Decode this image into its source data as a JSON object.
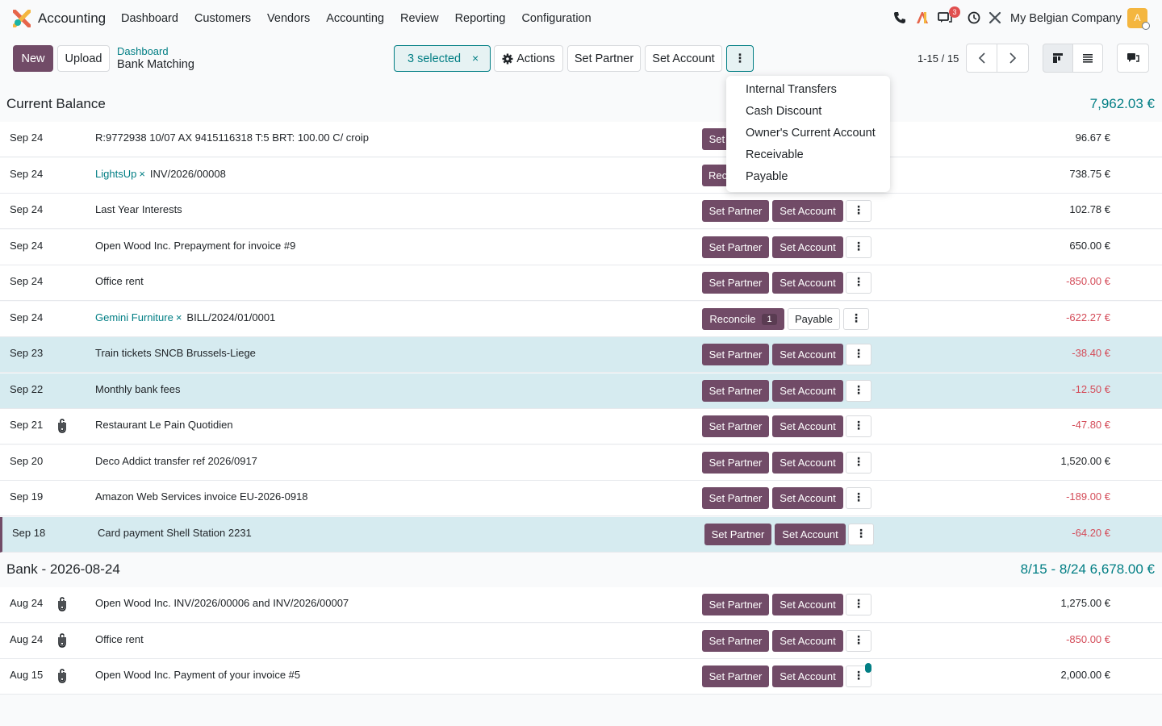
{
  "app": {
    "name": "Accounting",
    "menu": [
      "Dashboard",
      "Customers",
      "Vendors",
      "Accounting",
      "Review",
      "Reporting",
      "Configuration"
    ],
    "company": "My Belgian Company",
    "message_count": "3",
    "avatar_letter": "A"
  },
  "control": {
    "new_label": "New",
    "upload_label": "Upload",
    "breadcrumb_parent": "Dashboard",
    "breadcrumb_current": "Bank Matching",
    "selected_label": "3 selected",
    "actions_label": "Actions",
    "set_partner_label": "Set Partner",
    "set_account_label": "Set Account",
    "pager": "1-15 / 15"
  },
  "dropdown": {
    "items": [
      "Internal Transfers",
      "Cash Discount",
      "Owner's Current Account",
      "Receivable",
      "Payable"
    ]
  },
  "sections": [
    {
      "title": "Current Balance",
      "amount": "7,962.03 €",
      "rows": [
        {
          "date": "Sep 24",
          "attachment": false,
          "partner": "",
          "desc": "R:9772938 10/07 AX 9415116318 T:5 BRT: 100.00 C/ croip",
          "amount": "96.67 €",
          "negative": false,
          "selected": false,
          "buttons": "set"
        },
        {
          "date": "Sep 24",
          "attachment": false,
          "partner": "LightsUp",
          "desc": "INV/2026/00008",
          "amount": "738.75 €",
          "negative": false,
          "selected": false,
          "buttons": "reconcile"
        },
        {
          "date": "Sep 24",
          "attachment": false,
          "partner": "",
          "desc": "Last Year Interests",
          "amount": "102.78 €",
          "negative": false,
          "selected": false,
          "buttons": "set"
        },
        {
          "date": "Sep 24",
          "attachment": false,
          "partner": "",
          "desc": "Open Wood Inc. Prepayment for invoice #9",
          "amount": "650.00 €",
          "negative": false,
          "selected": false,
          "buttons": "set"
        },
        {
          "date": "Sep 24",
          "attachment": false,
          "partner": "",
          "desc": "Office rent",
          "amount": "-850.00 €",
          "negative": true,
          "selected": false,
          "buttons": "set"
        },
        {
          "date": "Sep 24",
          "attachment": false,
          "partner": "Gemini Furniture",
          "desc": "BILL/2024/01/0001",
          "amount": "-622.27 €",
          "negative": true,
          "selected": false,
          "buttons": "reconcile_payable"
        },
        {
          "date": "Sep 23",
          "attachment": false,
          "partner": "",
          "desc": "Train tickets SNCB Brussels-Liege",
          "amount": "-38.40 €",
          "negative": true,
          "selected": true,
          "buttons": "set"
        },
        {
          "date": "Sep 22",
          "attachment": false,
          "partner": "",
          "desc": "Monthly bank fees",
          "amount": "-12.50 €",
          "negative": true,
          "selected": true,
          "buttons": "set"
        },
        {
          "date": "Sep 21",
          "attachment": true,
          "partner": "",
          "desc": "Restaurant Le Pain Quotidien",
          "amount": "-47.80 €",
          "negative": true,
          "selected": false,
          "buttons": "set"
        },
        {
          "date": "Sep 20",
          "attachment": false,
          "partner": "",
          "desc": "Deco Addict transfer ref 2026/0917",
          "amount": "1,520.00 €",
          "negative": false,
          "selected": false,
          "buttons": "set"
        },
        {
          "date": "Sep 19",
          "attachment": false,
          "partner": "",
          "desc": "Amazon Web Services invoice EU-2026-0918",
          "amount": "-189.00 €",
          "negative": true,
          "selected": false,
          "buttons": "set"
        },
        {
          "date": "Sep 18",
          "attachment": false,
          "partner": "",
          "desc": "Card payment Shell Station 2231",
          "amount": "-64.20 €",
          "negative": true,
          "selected": true,
          "buttons": "set"
        }
      ]
    },
    {
      "title": "Bank - 2026-08-24",
      "amount": "8/15 - 8/24  6,678.00 €",
      "rows": [
        {
          "date": "Aug 24",
          "attachment": true,
          "partner": "",
          "desc": "Open Wood Inc. INV/2026/00006 and INV/2026/00007",
          "amount": "1,275.00 €",
          "negative": false,
          "selected": false,
          "buttons": "set"
        },
        {
          "date": "Aug 24",
          "attachment": true,
          "partner": "",
          "desc": "Office rent",
          "amount": "-850.00 €",
          "negative": true,
          "selected": false,
          "buttons": "set"
        },
        {
          "date": "Aug 15",
          "attachment": true,
          "partner": "",
          "desc": "Open Wood Inc. Payment of your invoice #5",
          "amount": "2,000.00 €",
          "negative": false,
          "selected": false,
          "buttons": "set"
        }
      ]
    }
  ],
  "row_labels": {
    "set_partner": "Set Partner",
    "set_account": "Set Account",
    "reconcile": "Reconcile",
    "reconcile_count": "1",
    "payable": "Payable",
    "partner_remove": "×"
  },
  "icons": [
    "phone-icon",
    "ai-icon",
    "chat-icon",
    "clock-icon",
    "tools-icon",
    "gear-icon",
    "chevron-left-icon",
    "chevron-right-icon",
    "kanban-view-icon",
    "list-view-icon",
    "chatter-icon",
    "paperclip-icon",
    "kebab-icon"
  ],
  "colors": {
    "primary": "#714b67",
    "teal": "#017e84",
    "negative": "#d44c59",
    "selected_row": "#d6ebf0"
  }
}
